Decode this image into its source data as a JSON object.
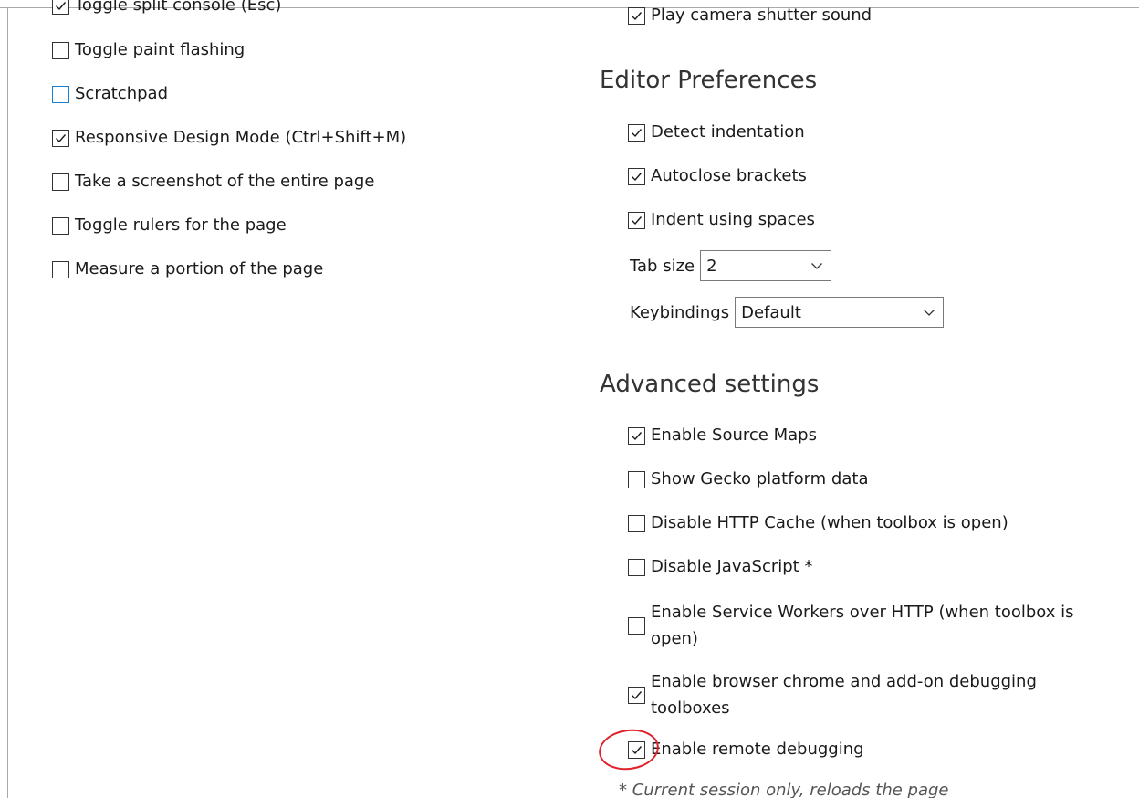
{
  "left_options": [
    {
      "label": "Toggle split console (Esc)",
      "checked": true
    },
    {
      "label": "Toggle paint flashing",
      "checked": false
    },
    {
      "label": "Scratchpad",
      "checked": false,
      "focused": true
    },
    {
      "label": "Responsive Design Mode (Ctrl+Shift+M)",
      "checked": true
    },
    {
      "label": "Take a screenshot of the entire page",
      "checked": false
    },
    {
      "label": "Toggle rulers for the page",
      "checked": false
    },
    {
      "label": "Measure a portion of the page",
      "checked": false
    }
  ],
  "screenshot_options": [
    {
      "label": "Play camera shutter sound",
      "checked": true
    }
  ],
  "editor_preferences": {
    "heading": "Editor Preferences",
    "options": [
      {
        "label": "Detect indentation",
        "checked": true
      },
      {
        "label": "Autoclose brackets",
        "checked": true
      },
      {
        "label": "Indent using spaces",
        "checked": true
      }
    ],
    "tab_size": {
      "label": "Tab size",
      "value": "2"
    },
    "keybindings": {
      "label": "Keybindings",
      "value": "Default"
    }
  },
  "advanced_settings": {
    "heading": "Advanced settings",
    "options": [
      {
        "label": "Enable Source Maps",
        "checked": true
      },
      {
        "label": "Show Gecko platform data",
        "checked": false
      },
      {
        "label": "Disable HTTP Cache (when toolbox is open)",
        "checked": false
      },
      {
        "label": "Disable JavaScript *",
        "checked": false
      },
      {
        "label": "Enable Service Workers over HTTP (when toolbox is open)",
        "checked": false
      },
      {
        "label": "Enable browser chrome and add-on debugging toolboxes",
        "checked": true
      },
      {
        "label": "Enable remote debugging",
        "checked": true,
        "annotated": true
      }
    ],
    "footnote": "* Current session only, reloads the page"
  },
  "colors": {
    "focus_border": "#1a7fd4",
    "annotation": "#e0202a"
  }
}
